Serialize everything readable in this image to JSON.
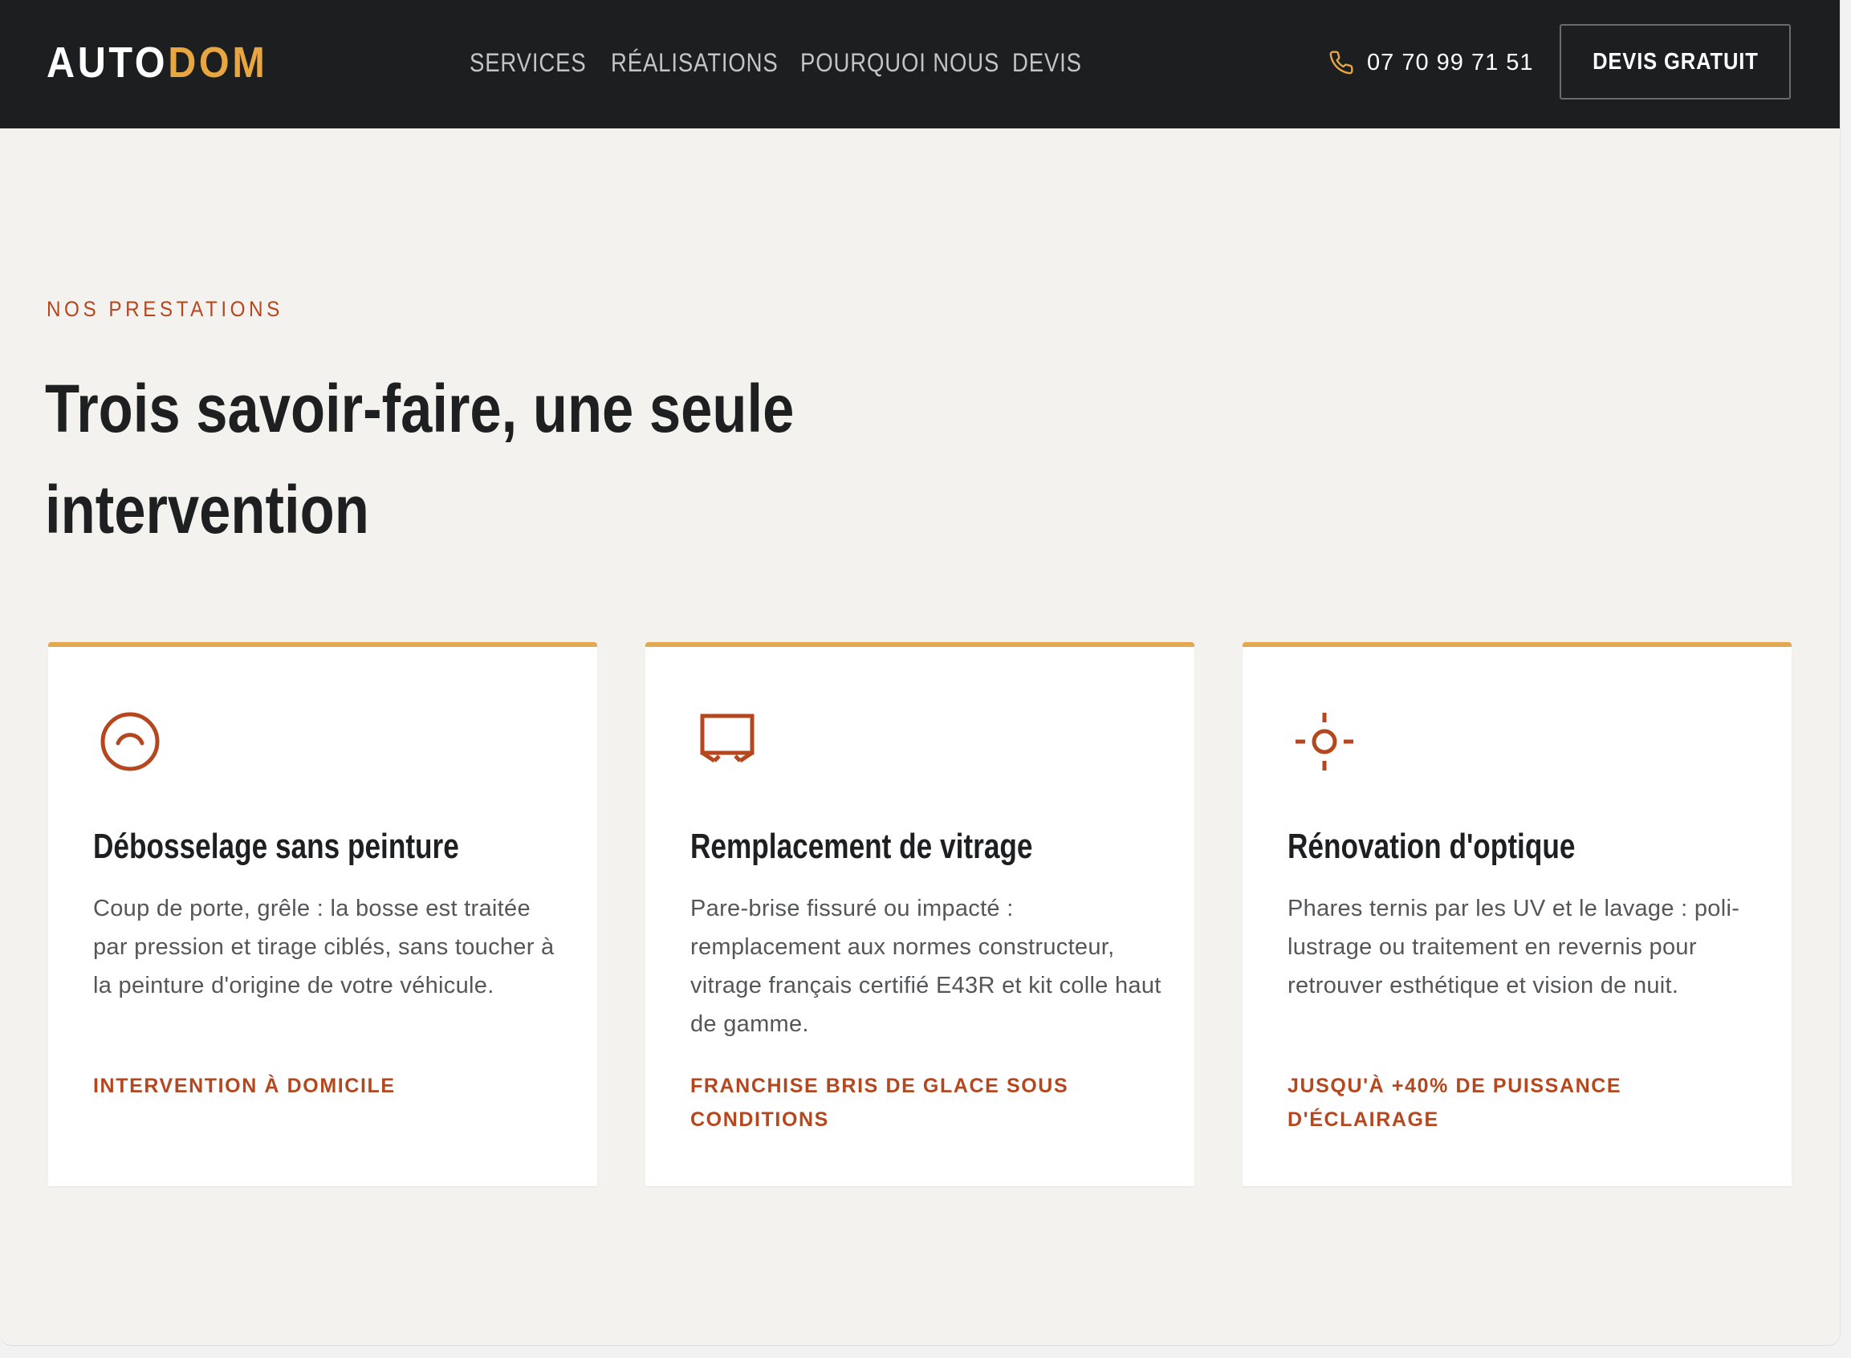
{
  "header": {
    "logo_part_a": "AUTO",
    "logo_part_b": "DOM",
    "nav": [
      {
        "label": "SERVICES"
      },
      {
        "label": "RÉALISATIONS"
      },
      {
        "label": "POURQUOI NOUS"
      },
      {
        "label": "DEVIS"
      }
    ],
    "phone": "07 70 99 71 51",
    "phone_icon": "phone-icon",
    "cta_label": "DEVIS GRATUIT"
  },
  "section": {
    "eyebrow": "NOS PRESTATIONS",
    "title": "Trois savoir-faire, une seule intervention"
  },
  "cards": [
    {
      "icon": "dent-circle-icon",
      "title": "Débosselage sans peinture",
      "description": "Coup de porte, grêle : la bosse est traitée par pression et tirage ciblés, sans toucher à la peinture d'origine de votre véhicule.",
      "tag": "INTERVENTION À DOMICILE"
    },
    {
      "icon": "windshield-icon",
      "title": "Remplacement de vitrage",
      "description": "Pare-brise fissuré ou impacté : remplacement aux normes constructeur, vitrage français certifié E43R et kit colle haut de gamme.",
      "tag": "FRANCHISE BRIS DE GLACE SOUS CONDITIONS"
    },
    {
      "icon": "headlight-target-icon",
      "title": "Rénovation d'optique",
      "description": "Phares ternis par les UV et le lavage : poli-lustrage ou traitement en revernis pour retrouver esthétique et vision de nuit.",
      "tag": "JUSQU'À +40% DE PUISSANCE D'ÉCLAIRAGE"
    }
  ],
  "colors": {
    "header_bg": "#1d1e20",
    "accent_gold": "#e8a640",
    "accent_rust": "#b5471f",
    "page_bg": "#f3f2ef",
    "card_bg": "#ffffff",
    "title_text": "#1e1f21",
    "body_text": "#555659"
  }
}
